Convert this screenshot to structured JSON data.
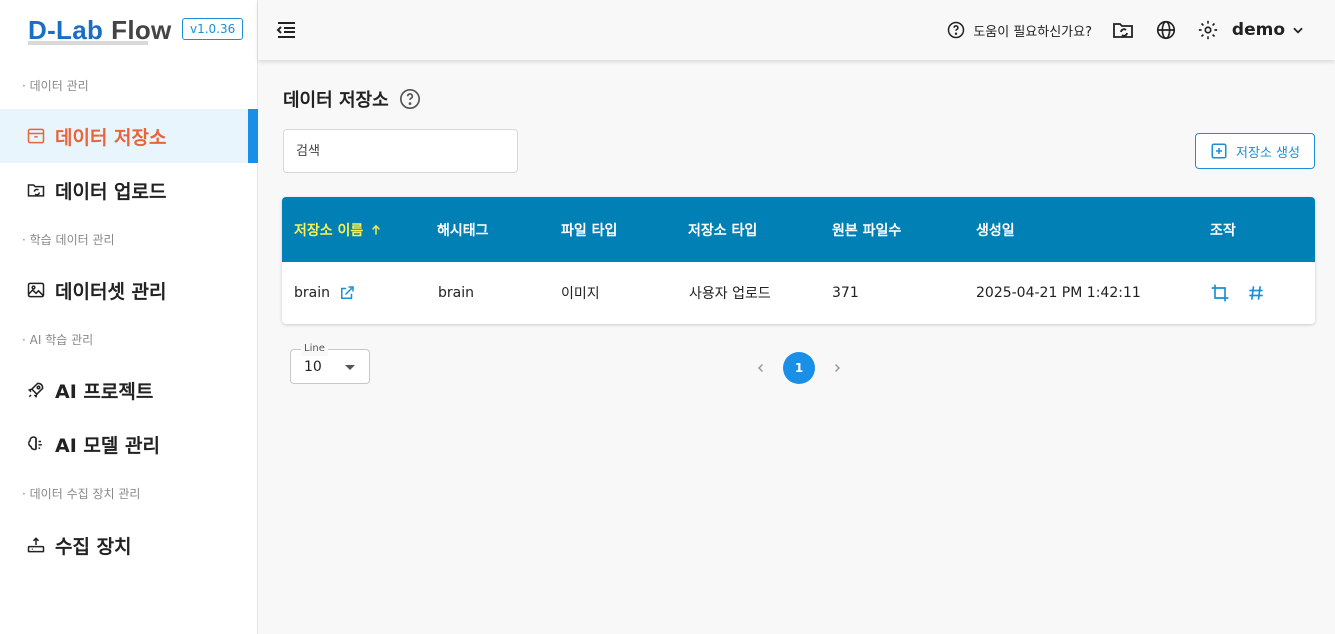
{
  "app": {
    "logo_prefix": "D-Lab",
    "logo_suffix": "Flow",
    "version": "v1.0.36"
  },
  "sidebar": {
    "sections": [
      {
        "label": "· 데이터 관리"
      },
      {
        "label": "· 학습 데이터 관리"
      },
      {
        "label": "· AI 학습 관리"
      },
      {
        "label": "· 데이터 수집 장치 관리"
      }
    ],
    "items": [
      {
        "label": "데이터 저장소",
        "icon": "archive-icon",
        "active": true
      },
      {
        "label": "데이터 업로드",
        "icon": "folder-sync-icon"
      },
      {
        "label": "데이터셋 관리",
        "icon": "image-icon"
      },
      {
        "label": "AI 프로젝트",
        "icon": "rocket-icon"
      },
      {
        "label": "AI 모델 관리",
        "icon": "brain-icon"
      },
      {
        "label": "수집 장치",
        "icon": "upload-device-icon"
      }
    ]
  },
  "header": {
    "help_text": "도움이 필요하신가요?",
    "user_name": "demo"
  },
  "main": {
    "title": "데이터 저장소",
    "search_placeholder": "검색",
    "create_button": "저장소 생성",
    "table": {
      "columns": [
        "저장소 이름",
        "해시태그",
        "파일 타입",
        "저장소 타입",
        "원본 파일수",
        "생성일",
        "조작"
      ],
      "rows": [
        {
          "name": "brain",
          "hashtag": "brain",
          "file_type": "이미지",
          "storage_type": "사용자 업로드",
          "file_count": "371",
          "created": "2025-04-21 PM 1:42:11"
        }
      ]
    },
    "pagination": {
      "line_label": "Line",
      "line_value": "10",
      "current_page": "1"
    }
  },
  "colors": {
    "accent": "#1a8fe8",
    "table_header": "#0080b5",
    "active_text": "#e8653a",
    "sorted_header": "#f7f052"
  }
}
